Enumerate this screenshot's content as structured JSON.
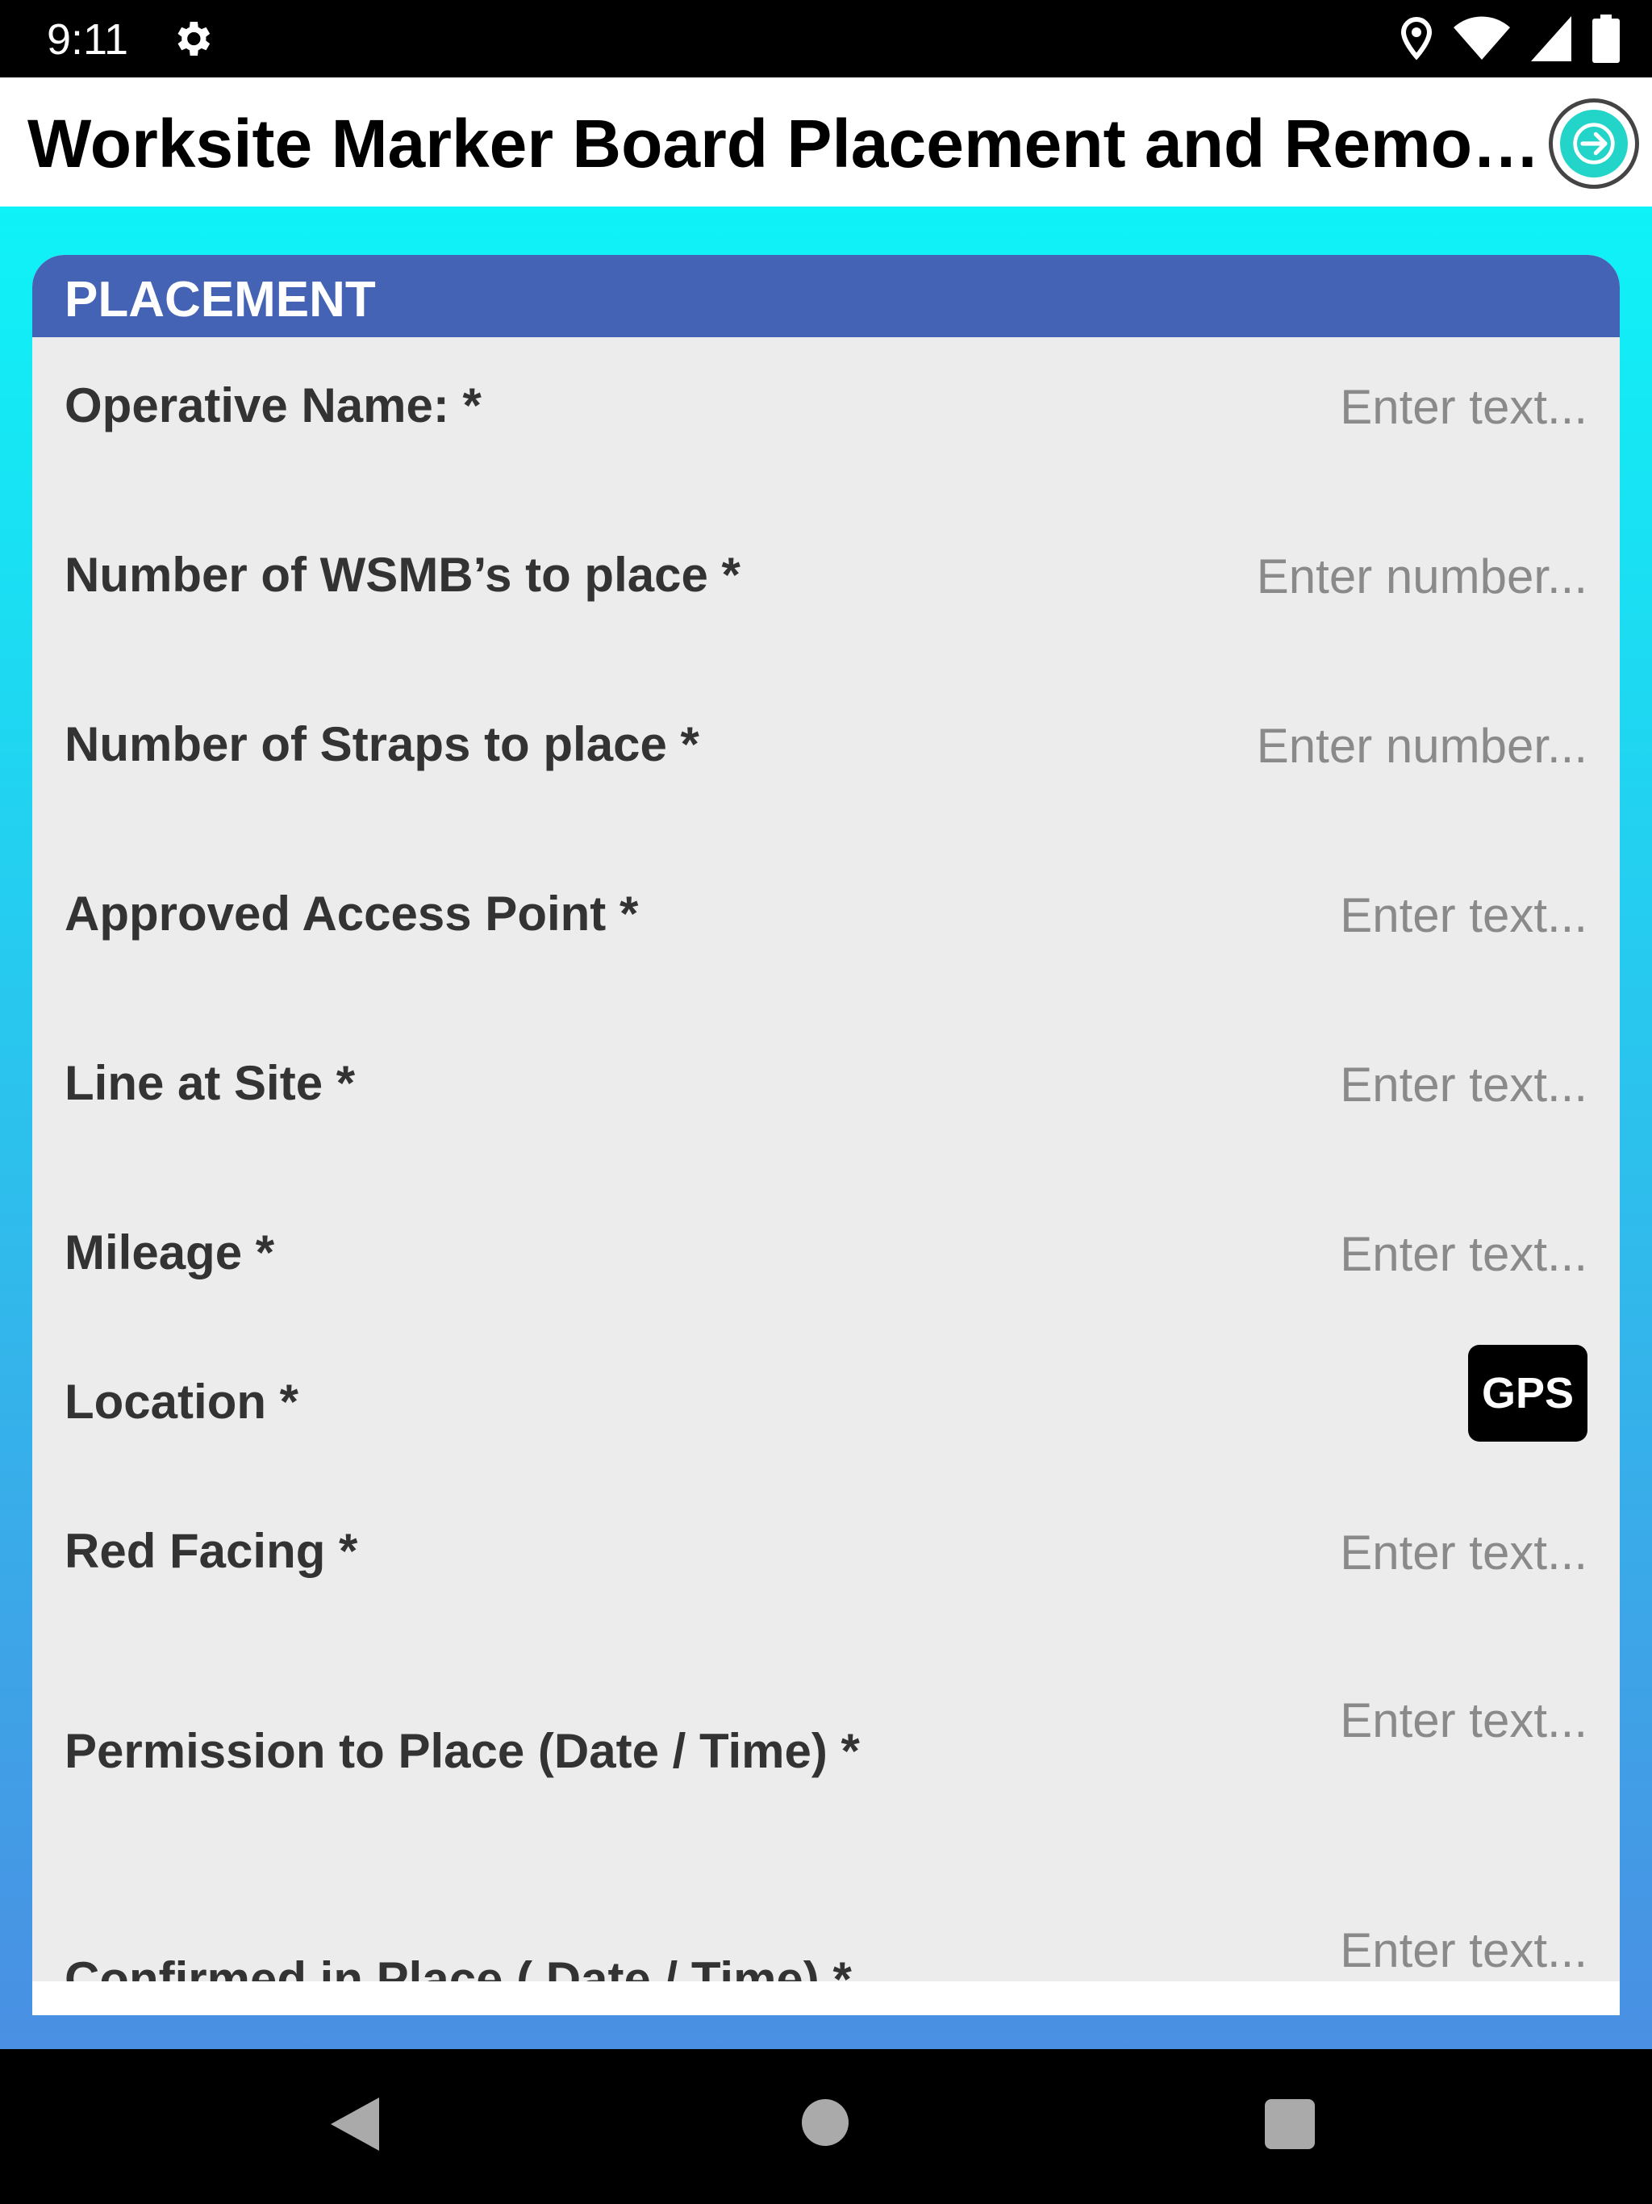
{
  "status_bar": {
    "time": "9:11",
    "icons": [
      "gear-icon",
      "location-pin-icon",
      "wifi-icon",
      "cell-signal-icon",
      "battery-icon"
    ]
  },
  "header": {
    "title": "Worksite Marker Board Placement and Removal",
    "next_icon": "arrow-right-circle-icon",
    "accent": "#23d5c8"
  },
  "section": {
    "title": "PLACEMENT",
    "color": "#4463b4"
  },
  "fields": [
    {
      "label": "Operative Name: *",
      "placeholder": "Enter text..."
    },
    {
      "label": "Number of WSMB’s to place *",
      "placeholder": "Enter number..."
    },
    {
      "label": "Number of Straps to place *",
      "placeholder": "Enter number..."
    },
    {
      "label": "Approved Access Point *",
      "placeholder": "Enter text..."
    },
    {
      "label": "Line at Site *",
      "placeholder": "Enter text..."
    },
    {
      "label": "Mileage *",
      "placeholder": "Enter text..."
    },
    {
      "label": "Location *",
      "button": "GPS"
    },
    {
      "label": "Red Facing *",
      "placeholder": "Enter text..."
    },
    {
      "label": "Permission to Place (Date / Time) *",
      "placeholder": "Enter text..."
    },
    {
      "label": "Confirmed in Place ( Date / Time) *",
      "placeholder": "Enter text..."
    }
  ],
  "nav_bar": {
    "icons": [
      "back-icon",
      "home-icon",
      "recents-icon"
    ]
  }
}
